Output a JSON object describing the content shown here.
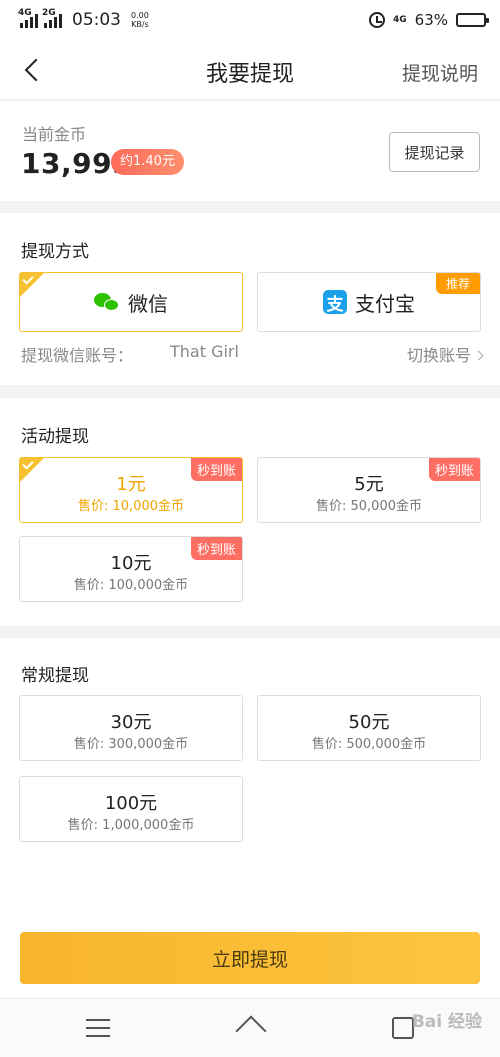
{
  "status_bar": {
    "net1": "4G",
    "net2": "2G",
    "time": "05:03",
    "speed": "0.00",
    "speed_unit": "KB/s",
    "net3": "4G",
    "battery": "63%",
    "battery_level": 0.63
  },
  "nav": {
    "title": "我要提现",
    "right_link": "提现说明"
  },
  "balance": {
    "label": "当前金币",
    "value": "13,995",
    "approx": "约1.40元",
    "records_button": "提现记录"
  },
  "methods": {
    "title": "提现方式",
    "wechat": {
      "label": "微信",
      "selected": true
    },
    "alipay": {
      "label": "支付宝",
      "tag": "推荐"
    },
    "account_label": "提现微信账号：",
    "account_name": "That Girl",
    "switch_label": "切换账号"
  },
  "activity": {
    "title": "活动提现",
    "options": [
      {
        "amount": "1元",
        "price": "售价: 10,000金币",
        "tag": "秒到账",
        "selected": true
      },
      {
        "amount": "5元",
        "price": "售价: 50,000金币",
        "tag": "秒到账"
      },
      {
        "amount": "10元",
        "price": "售价: 100,000金币",
        "tag": "秒到账"
      }
    ]
  },
  "regular": {
    "title": "常规提现",
    "options": [
      {
        "amount": "30元",
        "price": "售价: 300,000金币"
      },
      {
        "amount": "50元",
        "price": "售价: 500,000金币"
      },
      {
        "amount": "100元",
        "price": "售价: 1,000,000金币"
      }
    ]
  },
  "submit_label": "立即提现",
  "watermark": "Bai 经验"
}
